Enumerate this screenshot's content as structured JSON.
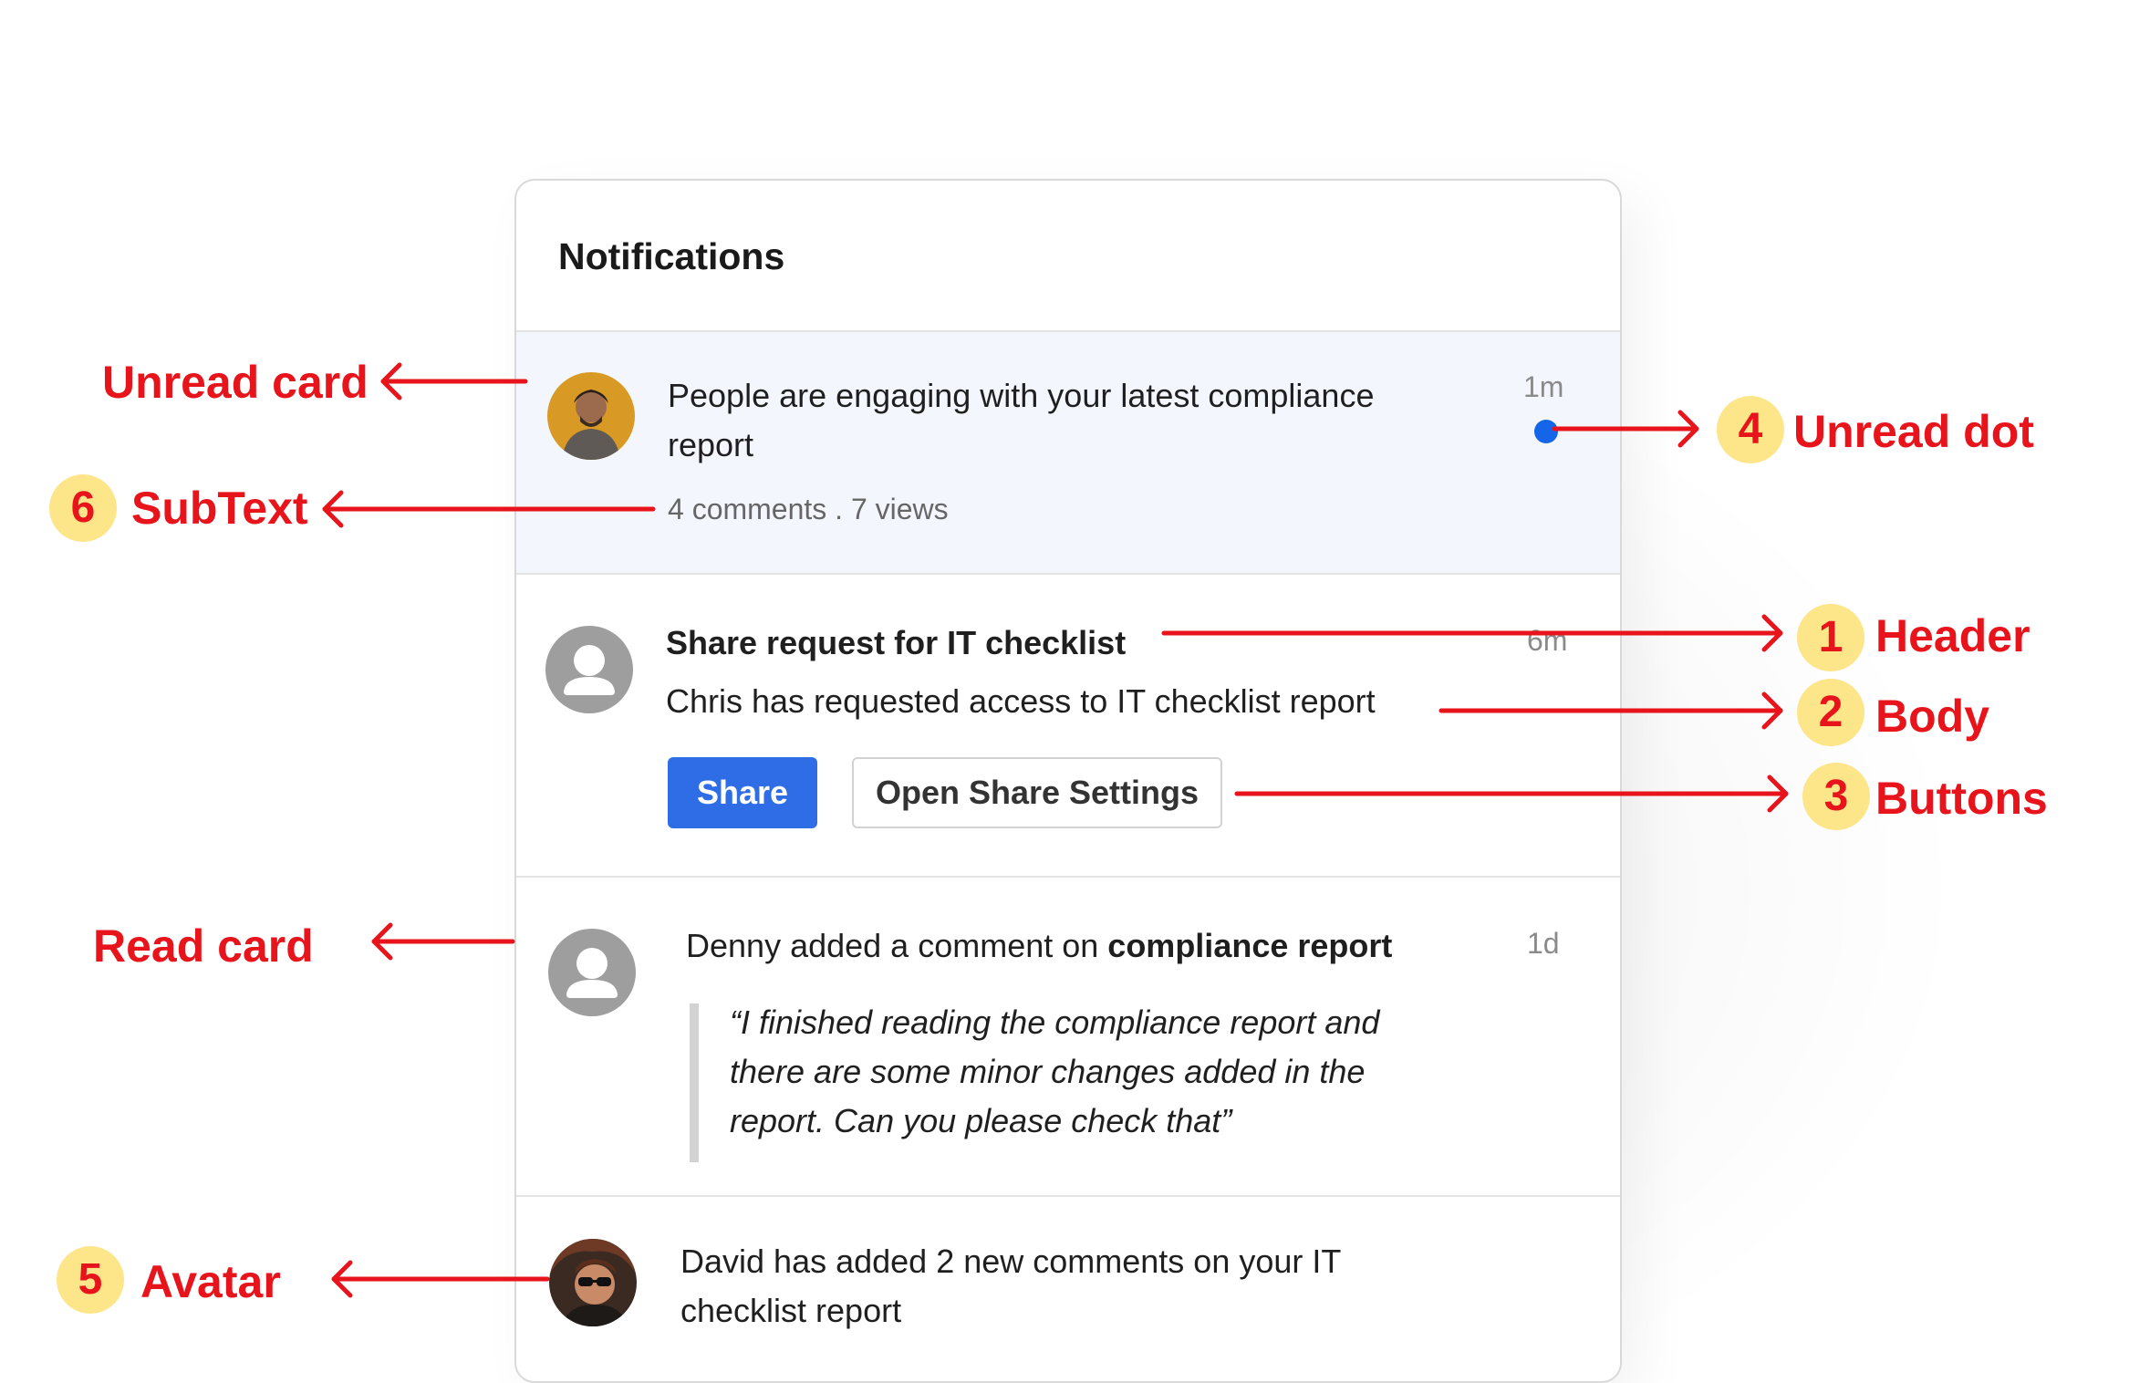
{
  "panel": {
    "title": "Notifications"
  },
  "notifications": [
    {
      "state": "unread",
      "text": "People are engaging with your latest compliance",
      "text_line2": "report",
      "subtext": "4 comments . 7 views",
      "time": "1m",
      "avatar": "person-photo"
    },
    {
      "state": "read",
      "header": "Share request for IT checklist",
      "body": "Chris has requested access to IT checklist report",
      "time": "6m",
      "avatar": "user-placeholder-icon",
      "buttons": {
        "primary": "Share",
        "secondary": "Open Share Settings"
      }
    },
    {
      "state": "read",
      "text_prefix": "Denny added a comment on ",
      "text_bold": "compliance report",
      "time": "1d",
      "avatar": "user-placeholder-icon",
      "quote_lines": [
        "“I finished reading the compliance report and",
        "there are some minor changes added in the",
        "report. Can you please check that”"
      ]
    },
    {
      "state": "read",
      "text": "David has added 2 new comments on your IT",
      "text_line2": "checklist report",
      "avatar": "person-photo-sunglasses"
    }
  ],
  "annotations": {
    "unread_card": "Unread card",
    "subtext": {
      "num": "6",
      "label": "SubText"
    },
    "unread_dot": {
      "num": "4",
      "label": "Unread dot"
    },
    "header": {
      "num": "1",
      "label": "Header"
    },
    "body": {
      "num": "2",
      "label": "Body"
    },
    "buttons": {
      "num": "3",
      "label": "Buttons"
    },
    "read_card": "Read card",
    "avatar": {
      "num": "5",
      "label": "Avatar"
    }
  },
  "colors": {
    "accent_blue": "#2f6de7",
    "unread_dot": "#1565e8",
    "unread_bg": "#f3f7fd",
    "annotation_red": "#e8141b",
    "badge_yellow": "#fde58a"
  }
}
